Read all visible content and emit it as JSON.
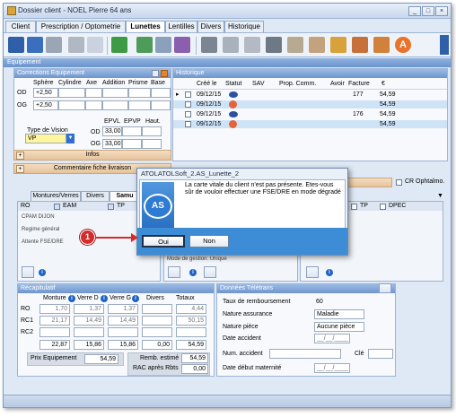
{
  "window": {
    "title": "Dossier client - NOEL Pierre 64 ans",
    "controls": [
      "minimize",
      "maximize",
      "close"
    ]
  },
  "tabs": [
    "Client",
    "Prescription / Optometrie",
    "Lunettes",
    "Lentilles",
    "Divers",
    "Historique"
  ],
  "active_tab": "Lunettes",
  "toolbar": {
    "icons": [
      "save-icon",
      "save-print-icon",
      "print-icon",
      "delete-icon",
      "copy-icon",
      "money-icon",
      "document-icon",
      "users-icon",
      "card-icon",
      "camera-icon",
      "frame-icon",
      "barcode-icon",
      "box-icon",
      "bag-icon",
      "label-icon",
      "pencil-icon",
      "print-color-icon",
      "gear-icon",
      "alert-icon"
    ],
    "alert_badge": "A"
  },
  "section_title": "Equipement",
  "correction": {
    "title": "Corrections Equipement",
    "columns": [
      "Sphère",
      "Cylindre",
      "Axe",
      "Addition",
      "Prisme",
      "Base"
    ],
    "od_label": "OD",
    "og_label": "OG",
    "od_sphere": "+2,50",
    "og_sphere": "+2,50",
    "vision_type_label": "Type de Vision",
    "vision_type_value": "VP",
    "epvl_label": "EPVL",
    "epvp_label": "EPVP",
    "haut_label": "Haut.",
    "od2_label": "OD",
    "og2_label": "OG",
    "od_epvl": "33,00",
    "og_epvl": "33,00"
  },
  "infos_label": "Infos",
  "commentaire_label": "Commentaire fiche livraison",
  "historique": {
    "title": "Historique",
    "columns": [
      "Créé le",
      "Statut",
      "SAV",
      "Prop. Comm.",
      "Avoir",
      "Facture",
      "€"
    ],
    "rows": [
      {
        "date": "09/12/15",
        "facture": "177",
        "amount": "54,59",
        "selected": false
      },
      {
        "date": "09/12/15",
        "facture": "",
        "amount": "54,59",
        "selected": true
      },
      {
        "date": "09/12/15",
        "facture": "176",
        "amount": "54,59",
        "selected": false
      },
      {
        "date": "09/12/15",
        "facture": "",
        "amount": "54,59",
        "selected": true
      }
    ]
  },
  "cr_ophtalmo": "CR Ophtalmo.",
  "subtabs": [
    "Montures/Verres",
    "Divers",
    "Samu"
  ],
  "tiers": {
    "ro_label": "RO",
    "eam_label": "EAM",
    "tp_label": "TP",
    "tp2_label": "TP",
    "dpec_label": "DPEC",
    "cpam": "CPAM DIJON",
    "regime": "Regime général",
    "attente": "Attente FSE/DRE",
    "mode_gestion": "Mode de gestion: Unique"
  },
  "dialog": {
    "title": "ATOLATOLSoft_2.AS_Lunette_2",
    "message": "La carte vitale du client n'est pas présente. Etes-vous sûr de vouloir effectuer une FSE/DRE en mode dégradé",
    "logo": "AS",
    "yes": "Oui",
    "no": "Non"
  },
  "callout_number": "1",
  "recap": {
    "title": "Récapitulatif",
    "columns": [
      "Monture",
      "Verre D",
      "Verre G",
      "Divers",
      "Totaux"
    ],
    "rows": [
      {
        "label": "RO",
        "values": [
          "1,70",
          "1,37",
          "1,37",
          "",
          "4,44"
        ]
      },
      {
        "label": "RC1",
        "values": [
          "21,17",
          "14,49",
          "14,49",
          "",
          "50,15"
        ]
      },
      {
        "label": "RC2",
        "values": [
          "",
          "",
          "",
          "",
          ""
        ]
      }
    ],
    "totals": [
      "22,87",
      "15,86",
      "15,86",
      "0,00",
      "54,59"
    ],
    "prix_label": "Prix Equipement",
    "prix_value": "54,59",
    "remb_label": "Remb. estimé",
    "remb_value": "54,59",
    "rac_label": "RAC après Rbts",
    "rac_value": "0,00"
  },
  "teletrans": {
    "title": "Données Télétrans",
    "taux_label": "Taux de remboursement",
    "taux_value": "60",
    "nature_assurance_label": "Nature assurance",
    "nature_assurance_value": "Maladie",
    "nature_piece_label": "Nature pièce",
    "nature_piece_value": "Aucune pièce",
    "date_accident_label": "Date accident",
    "date_accident_value": "__/__/____",
    "num_accident_label": "Num. accident",
    "cle_label": "Clé",
    "date_maternite_label": "Date début maternité",
    "date_maternite_value": "__/__/____"
  }
}
